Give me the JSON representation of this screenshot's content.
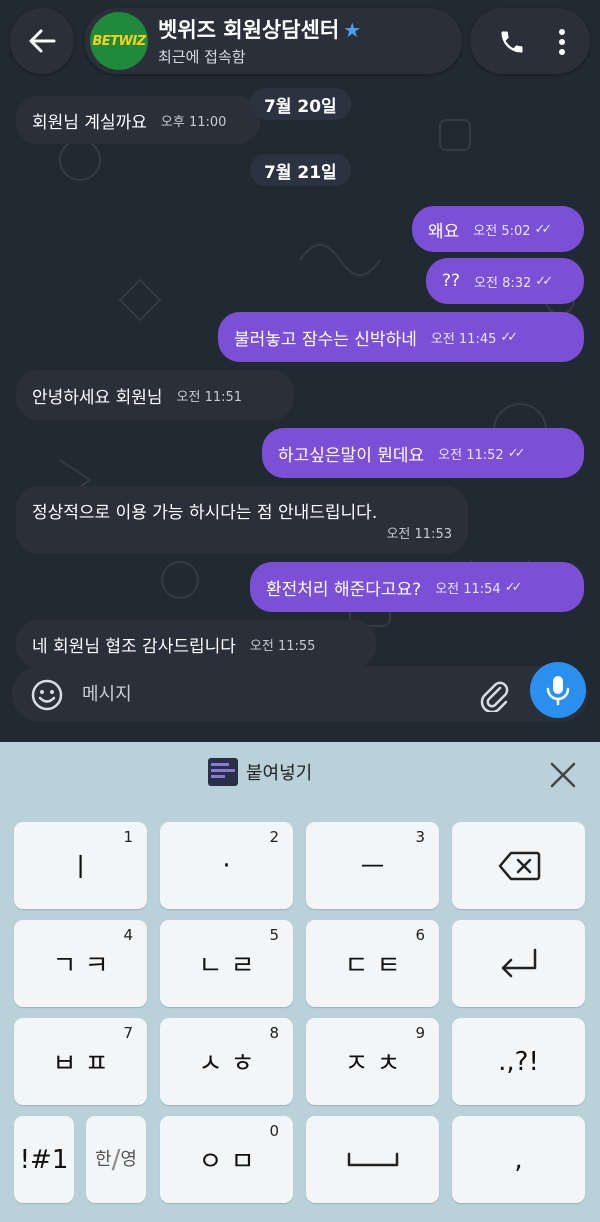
{
  "header": {
    "avatar_text": "BETWIZ",
    "title": "벳위즈 회원상담센터",
    "subtitle": "최근에 접속함"
  },
  "messages": [
    {
      "type": "date",
      "text": "7월 20일"
    },
    {
      "type": "in",
      "text": "회원님 계실까요",
      "time": "오후 11:00"
    },
    {
      "type": "date",
      "text": "7월 21일"
    },
    {
      "type": "out",
      "text": "왜요",
      "time": "오전 5:02"
    },
    {
      "type": "out",
      "text": "??",
      "time": "오전 8:32"
    },
    {
      "type": "out",
      "text": "불러놓고 잠수는 신박하네",
      "time": "오전 11:45"
    },
    {
      "type": "in",
      "text": "안녕하세요 회원님",
      "time": "오전 11:51"
    },
    {
      "type": "out",
      "text": "하고싶은말이 뭔데요",
      "time": "오전 11:52"
    },
    {
      "type": "in",
      "text": "정상적으로 이용 가능 하시다는 점 안내드립니다.",
      "time": "오전 11:53"
    },
    {
      "type": "out",
      "text": "환전처리 해준다고요?",
      "time": "오전 11:54"
    },
    {
      "type": "in",
      "text": "네 회원님 협조 감사드립니다",
      "time": "오전 11:55"
    }
  ],
  "composer": {
    "placeholder": "메시지"
  },
  "keyboard": {
    "paste_label": "붙여넣기",
    "keys": [
      {
        "label": "ㅣ",
        "num": "1"
      },
      {
        "label": "·",
        "num": "2"
      },
      {
        "label": "ㅡ",
        "num": "3"
      },
      {
        "label": "ㄱ ㅋ",
        "num": "4"
      },
      {
        "label": "ㄴ ㄹ",
        "num": "5"
      },
      {
        "label": "ㄷ ㅌ",
        "num": "6"
      },
      {
        "label": "ㅂ ㅍ",
        "num": "7"
      },
      {
        "label": "ㅅ ㅎ",
        "num": "8"
      },
      {
        "label": "ㅈ ㅊ",
        "num": "9"
      },
      {
        "label": ".,?!"
      },
      {
        "label": "!#1"
      },
      {
        "label_top": "한",
        "label_bottom": "영"
      },
      {
        "label": "ㅇ ㅁ",
        "num": "0"
      },
      {
        "label": ","
      }
    ]
  },
  "colors": {
    "outgoing": "#7b4fd6",
    "incoming": "#2a2f3a",
    "accent": "#2b8ff0",
    "keyboard": "#b9d1d8"
  },
  "icons": [
    "back-arrow-icon",
    "star-icon",
    "phone-icon",
    "more-vertical-icon",
    "emoji-icon",
    "attach-icon",
    "mic-icon",
    "paste-icon",
    "close-icon",
    "backspace-icon",
    "enter-icon",
    "space-icon"
  ]
}
